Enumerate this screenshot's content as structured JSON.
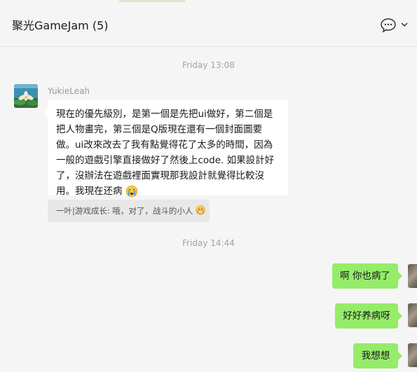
{
  "header": {
    "title": "聚光GameJam (5)",
    "icons": [
      "chat-bubble-icon",
      "chevron-down-icon"
    ]
  },
  "messages": {
    "timestamp_1": "Friday 13:08",
    "sender_name": "YukieLeah",
    "incoming_text": "現在的優先級別，是第一個是先把ui做好，第二個是把人物畫完，第三個是Q版現在還有一個封面圖要做。ui改來改去了我有點覺得花了太多的時間，因為一般的遊戲引擎直接做好了然後上code. 如果設計好了，沒辦法在遊戲裡面實現那我設計就覺得比較沒用。我現在还病",
    "incoming_emoji": "crying-face-emoji",
    "quote_text": "一叶|游戏成长: 哦，对了，战斗的小人",
    "quote_emoji": "grimacing-face-emoji",
    "timestamp_2": "Friday 14:44",
    "outgoing_1": "啊 你也病了",
    "outgoing_2": "好好养病呀",
    "outgoing_3": "我想想"
  },
  "colors": {
    "background": "#f5f5f5",
    "outgoing_bubble": "#95ec69",
    "incoming_bubble": "#ffffff",
    "quote_bubble": "#e8e8e8"
  }
}
